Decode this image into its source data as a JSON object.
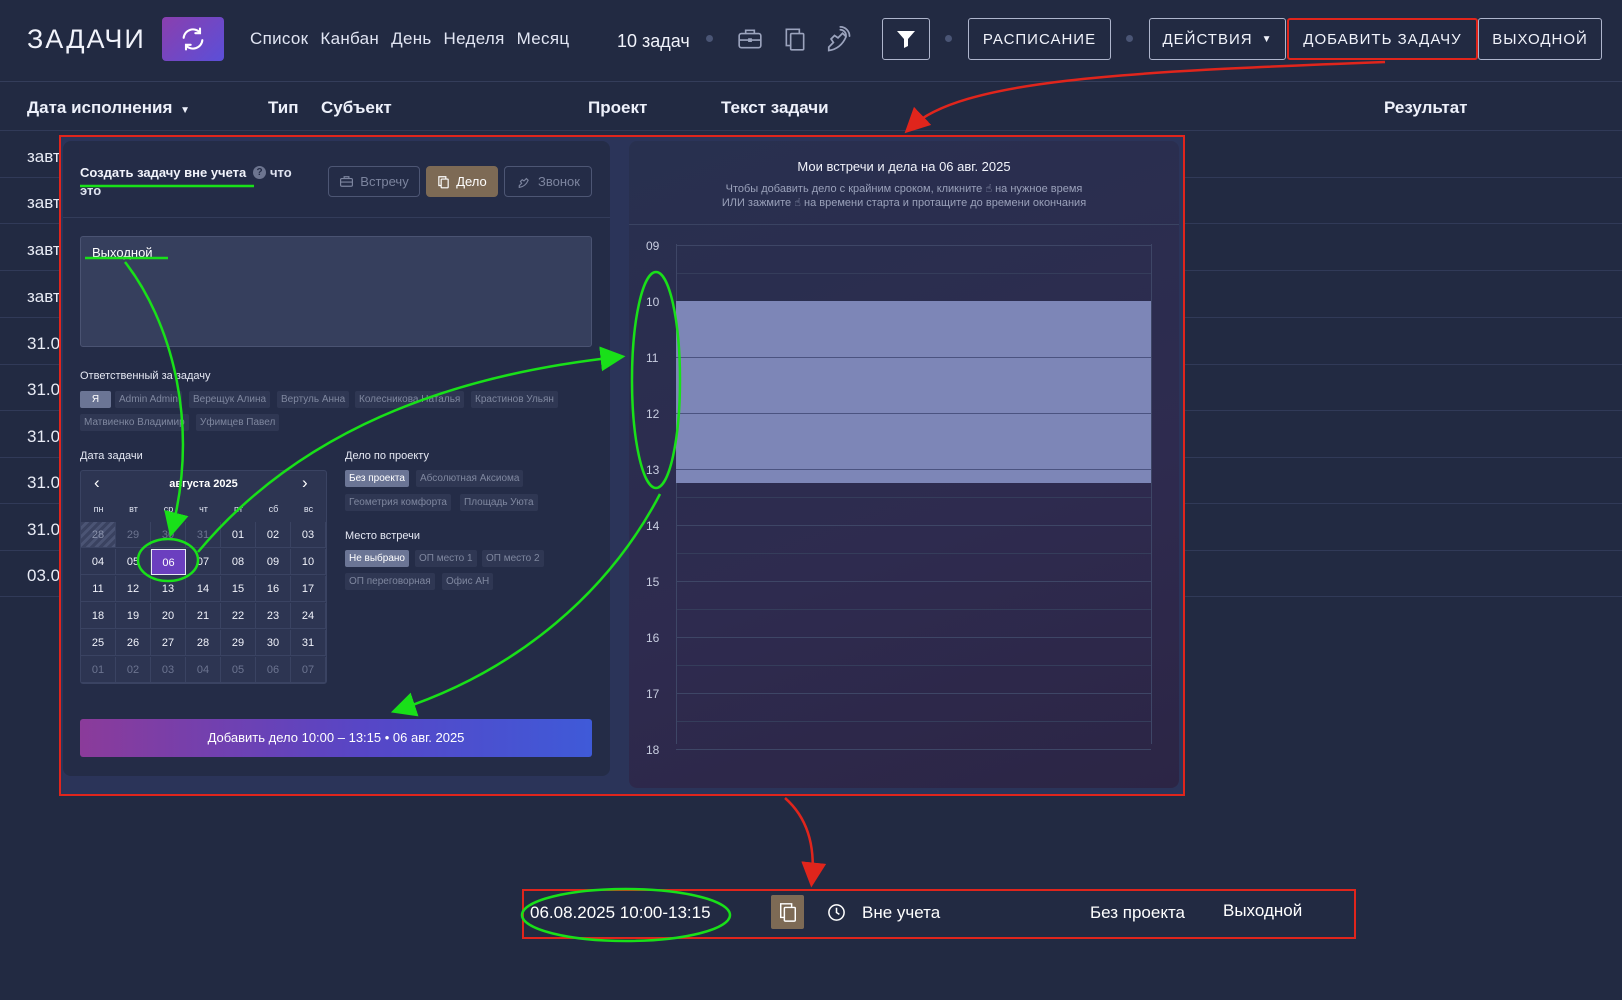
{
  "header": {
    "title": "ЗАДАЧИ",
    "views": [
      "Список",
      "Канбан",
      "День",
      "Неделя",
      "Месяц"
    ],
    "task_count": "10 задач",
    "buttons": {
      "schedule": "РАСПИСАНИЕ",
      "actions": "ДЕЙСТВИЯ",
      "add_task": "ДОБАВИТЬ ЗАДАЧУ",
      "day_off": "ВЫХОДНОЙ"
    }
  },
  "table": {
    "columns": {
      "due_date": "Дата исполнения",
      "type": "Тип",
      "subject": "Субъект",
      "project": "Проект",
      "text": "Текст задачи",
      "result": "Результат"
    },
    "row_dates": [
      "завт",
      "завт",
      "завт",
      "завт",
      "31.0",
      "31.0",
      "31.0",
      "31.0",
      "31.0",
      "03.0"
    ]
  },
  "modal": {
    "title": "Создать задачу вне учета",
    "help_link_1": "что",
    "help_link_2": "это",
    "types": [
      "Встречу",
      "Дело",
      "Звонок"
    ],
    "active_type": "Дело",
    "task_text": "Выходной",
    "responsible_label": "Ответственный за задачу",
    "responsible": [
      "Я",
      "Admin Admin",
      "Верещук Алина",
      "Вертуль Анна",
      "Колесникова Наталья",
      "Крастинов Ульян",
      "Матвиенко Владимир",
      "Уфимцев Павел"
    ],
    "date_label": "Дата задачи",
    "calendar": {
      "month": "августа 2025",
      "weekdays": [
        "пн",
        "вт",
        "ср",
        "чт",
        "пт",
        "сб",
        "вс"
      ],
      "days": [
        "28",
        "29",
        "30",
        "31",
        "01",
        "02",
        "03",
        "04",
        "05",
        "06",
        "07",
        "08",
        "09",
        "10",
        "11",
        "12",
        "13",
        "14",
        "15",
        "16",
        "17",
        "18",
        "19",
        "20",
        "21",
        "22",
        "23",
        "24",
        "25",
        "26",
        "27",
        "28",
        "29",
        "30",
        "31",
        "01",
        "02",
        "03",
        "04",
        "05",
        "06",
        "07"
      ],
      "selected": "06"
    },
    "project_label": "Дело по проекту",
    "projects": [
      "Без проекта",
      "Абсолютная Аксиома",
      "Геометрия комфорта",
      "Площадь Уюта"
    ],
    "place_label": "Место встречи",
    "places": [
      "Не выбрано",
      "ОП место 1",
      "ОП место 2",
      "ОП переговорная",
      "Офис АН"
    ],
    "submit": "Добавить дело 10:00 – 13:15 • 06 авг. 2025"
  },
  "schedule": {
    "title": "Мои встречи и дела на 06 авг. 2025",
    "hint_1": "Чтобы добавить дело с крайним сроком, кликните",
    "hint_1b": "на нужное время",
    "hint_2": "ИЛИ зажмите",
    "hint_2b": "на времени старта и протащите до времени окончания",
    "hours": [
      "09",
      "10",
      "11",
      "12",
      "13",
      "14",
      "15",
      "16",
      "17",
      "18"
    ],
    "event_start": "10:00",
    "event_end": "13:15"
  },
  "result_row": {
    "datetime": "06.08.2025 10:00-13:15",
    "status": "Вне учета",
    "project": "Без проекта",
    "text": "Выходной"
  },
  "colors": {
    "background": "#222a42",
    "accent_red": "#e0251c",
    "accent_green": "#19e019",
    "event": "#7d86b7",
    "task_type": "#7d6a55"
  }
}
